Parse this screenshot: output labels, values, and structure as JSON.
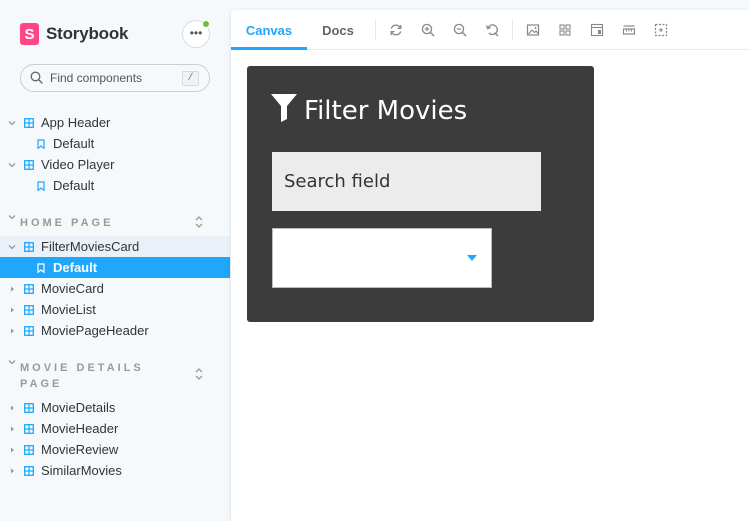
{
  "brand": {
    "name": "Storybook",
    "mark": "S"
  },
  "search": {
    "placeholder": "Find components",
    "shortcut": "/"
  },
  "tree": {
    "app_header": {
      "label": "App Header",
      "stories": [
        "Default"
      ]
    },
    "video_player": {
      "label": "Video Player",
      "stories": [
        "Default"
      ]
    },
    "home_page": {
      "group_label": "HOME PAGE",
      "components": [
        "FilterMoviesCard",
        "MovieCard",
        "MovieList",
        "MoviePageHeader"
      ],
      "selected_story": "Default"
    },
    "movie_details_page": {
      "group_label": "MOVIE DETAILS PAGE",
      "components": [
        "MovieDetails",
        "MovieHeader",
        "MovieReview",
        "SimilarMovies"
      ]
    }
  },
  "toolbar": {
    "tabs": [
      "Canvas",
      "Docs"
    ],
    "active_tab": "Canvas",
    "icons": [
      "reload-icon",
      "zoom-in-icon",
      "zoom-out-icon",
      "reset-zoom-icon",
      "background-icon",
      "grid-icon",
      "viewport-icon",
      "measure-icon",
      "outline-icon"
    ]
  },
  "preview": {
    "card_title": "Filter Movies",
    "search_placeholder": "Search field",
    "select_value": ""
  },
  "colors": {
    "accent": "#1ea7fd",
    "brand": "#ff4785",
    "card_bg": "#3c3c3c",
    "status_dot": "#66bf3c"
  }
}
